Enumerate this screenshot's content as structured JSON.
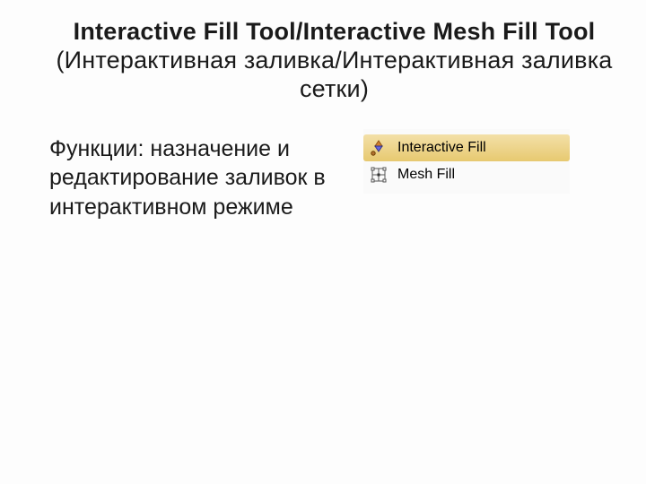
{
  "title": {
    "bold_part": "Interactive Fill Tool/Interactive Mesh Fill Tool",
    "rest_part": " (Интерактивная заливка/Интерактивная заливка сетки)"
  },
  "functions_text": "Функции: назначение и редактирование заливок в интерактивном режиме",
  "tools": {
    "item0": {
      "label": "Interactive Fill"
    },
    "item1": {
      "label": "Mesh Fill"
    }
  }
}
